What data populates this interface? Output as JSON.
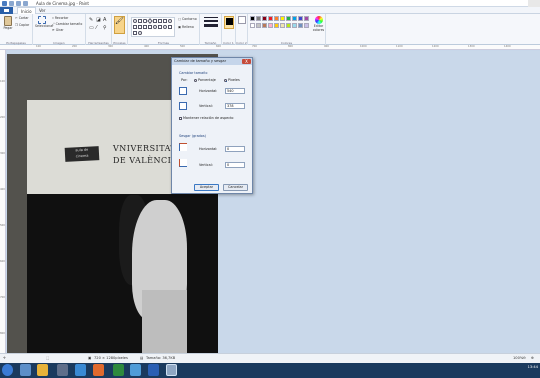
{
  "window": {
    "title": "Aula de Cinema.jpg - Paint"
  },
  "menu": {
    "file": "",
    "tabs": [
      "Inicio",
      "Ver"
    ],
    "active": "Inicio"
  },
  "ribbon": {
    "clipboard": {
      "label": "Portapapeles",
      "paste": "Pegar",
      "cut": "Cortar",
      "copy": "Copiar"
    },
    "image": {
      "label": "Imagen",
      "select": "Seleccionar",
      "crop": "Recortar",
      "resize": "Cambiar tamaño",
      "rotate": "Girar"
    },
    "tools": {
      "label": "Herramientas"
    },
    "brushes": {
      "label": "Pinceles"
    },
    "shapes": {
      "label": "Formas",
      "outline": "Contorno",
      "fill": "Relleno"
    },
    "size": {
      "label": "Tamaño"
    },
    "color1": {
      "label": "Color 1"
    },
    "color2": {
      "label": "Color 2"
    },
    "colors": {
      "label": "Colores",
      "edit": "Editar colores"
    },
    "palette": [
      "#000000",
      "#7f7f7f",
      "#880015",
      "#ed1c24",
      "#ff7f27",
      "#fff200",
      "#22b14c",
      "#00a2e8",
      "#3f48cc",
      "#a349a4",
      "#ffffff",
      "#c3c3c3",
      "#b97a57",
      "#ffaec9",
      "#ffc90e",
      "#efe4b0",
      "#b5e61d",
      "#99d9ea",
      "#7092be",
      "#c8bfe7"
    ]
  },
  "ruler": {
    "h": [
      "100",
      "200",
      "300",
      "400",
      "500",
      "600",
      "700",
      "800",
      "900",
      "1000",
      "1100",
      "1200",
      "1300",
      "1400"
    ],
    "v": [
      "100",
      "200",
      "300",
      "400",
      "500",
      "600",
      "700",
      "800"
    ]
  },
  "image": {
    "univ1": "VNIVERSITAT",
    "univ2": "DE VALÈNCIA",
    "tag1": "aula de",
    "tag2": "cinema"
  },
  "dialog": {
    "title": "Cambiar de tamaño y sesgar",
    "close": "X",
    "resize_label": "Cambiar tamaño",
    "by_label": "Por:",
    "percent": "Porcentaje",
    "pixels": "Píxeles",
    "horizontal_label": "Horizontal:",
    "horizontal_value": "540",
    "vertical_label": "Vertical:",
    "vertical_value": "378",
    "keep_ratio": "Mantener relación de aspecto",
    "skew_label": "Sesgar (grados)",
    "skew_h_label": "Horizontal:",
    "skew_h_value": "0",
    "skew_v_label": "Vertical:",
    "skew_v_value": "0",
    "ok": "Aceptar",
    "cancel": "Cancelar"
  },
  "status": {
    "dims": "720 × 1280píxeles",
    "size": "Tamaño: 36,7KB",
    "zoom": "100%"
  },
  "taskbar": {
    "tray": "13:44"
  }
}
